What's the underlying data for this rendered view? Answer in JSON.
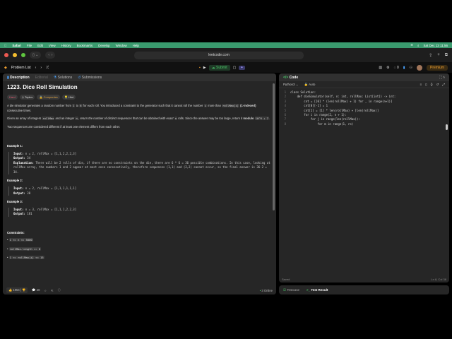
{
  "menubar": {
    "app": "Safari",
    "items": [
      "File",
      "Edit",
      "View",
      "History",
      "Bookmarks",
      "Develop",
      "Window",
      "Help"
    ],
    "clock": "Sat Dec 13  11:56"
  },
  "browser": {
    "url": "leetcode.com"
  },
  "nav": {
    "problem_list": "Problem List",
    "submit": "Submit",
    "streak": "0",
    "premium": "Premium"
  },
  "desc_tabs": [
    "Description",
    "Editorial",
    "Solutions",
    "Submissions"
  ],
  "problem": {
    "title": "1223. Dice Roll Simulation",
    "tags": [
      "Hard",
      "Topics",
      "Companies",
      "Hint"
    ],
    "p1a": "A die simulator generates a random number from ",
    "c1": "1",
    "p1b": " to ",
    "c6": "6",
    "p1c": " for each roll. You introduced a constraint to the generator such that it cannot roll the number ",
    "ci": "i",
    "p1d": " more than ",
    "crm": "rollMax[i]",
    "p1e": " (1-indexed)",
    "p1f": " consecutive times.",
    "p2a": "Given an array of integers ",
    "c_rollMax": "rollMax",
    "p2b": " and an integer ",
    "cn": "n",
    "p2c": ", return the number of distinct sequences that can be obtained with exact ",
    "p2d": " rolls. Since the answer may be too large, return it ",
    "p2e": "modulo",
    "cmod": "10^9 + 7",
    "p3": "Two sequences are considered different if at least one element differs from each other.",
    "examples": [
      {
        "title": "Example 1:",
        "input": "n = 2, rollMax = [1,1,2,2,2,3]",
        "output": "34",
        "explanation": "There will be 2 rolls of die, if there are no constraints on the die, there are 6 * 6 = 36 possible combinations. In this case, looking at rollMax array, the numbers 1 and 2 appear at most once consecutively, therefore sequences (1,1) and (2,2) cannot occur, so the final answer is 36-2 = 34."
      },
      {
        "title": "Example 2:",
        "input": "n = 2, rollMax = [1,1,1,1,1,1]",
        "output": "30"
      },
      {
        "title": "Example 3:",
        "input": "n = 3, rollMax = [1,1,1,2,2,3]",
        "output": "181"
      }
    ],
    "labels": {
      "input": "Input:",
      "output": "Output:",
      "explanation": "Explanation:"
    },
    "constraints_title": "Constraints:",
    "constraints": [
      "1 <= n <= 5000",
      "rollMax.length == 6",
      "1 <= rollMax[i] <= 15"
    ]
  },
  "desc_footer": {
    "likes": "1954",
    "comments": "28",
    "online": "3 Online"
  },
  "code": {
    "title": "Code",
    "language": "Python3",
    "mode": "Auto",
    "status": "Saved",
    "cursor": "Ln 8, Col 38",
    "lines": [
      "class Solution:",
      "    def dieSimulator(self, n: int, rollMax: List[int]) -> int:",
      "        cnt = [[0] * (len(rollMax) + 1) for _ in range(n+1)]",
      "        cnt[0][-1] = 1",
      "        cnt[1] = [1] * len(rollMax) + [len(rollMax)]",
      "        for i in range(2, n + 1):",
      "            for j in range(len(rollMax)):",
      "                for m in range(1, ro)"
    ]
  },
  "bottom_tabs": [
    "Testcase",
    "Test Result"
  ]
}
